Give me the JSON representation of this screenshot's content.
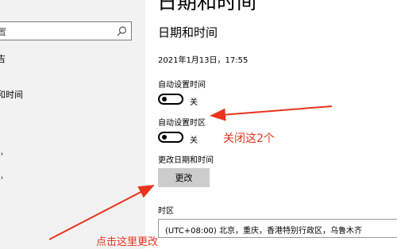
{
  "sidebar": {
    "search_text": "置",
    "items": [
      "吉",
      "和时间"
    ],
    "marks": [
      "，",
      "，"
    ]
  },
  "main": {
    "big_title": "日期和时间",
    "sub_title": "日期和时间",
    "datetime": "2021年1月13日，17:55",
    "auto_time_label": "自动设置时间",
    "auto_time_state": "关",
    "auto_zone_label": "自动设置时区",
    "auto_zone_state": "关",
    "change_label": "更改日期和时间",
    "change_button": "更改",
    "timezone_label": "时区",
    "timezone_value": "(UTC+08:00) 北京，重庆，香港特别行政区，乌鲁木齐"
  },
  "annotations": {
    "close_two": "关闭这2个",
    "click_here": "点击这里更改"
  },
  "colors": {
    "annotation": "#e8341c",
    "sidebar_bg": "#f2f2f2",
    "button_bg": "#cccccc"
  },
  "icons": [
    "search-icon",
    "chevron-down-icon"
  ]
}
